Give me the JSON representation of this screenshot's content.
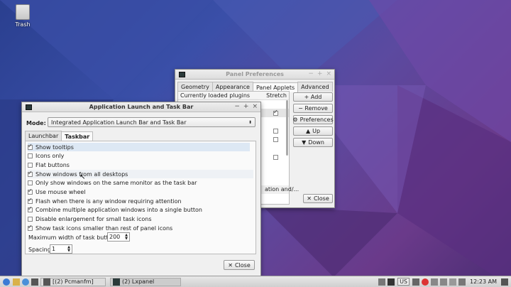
{
  "desktop": {
    "trash_label": "Trash"
  },
  "panel_prefs": {
    "title": "Panel Preferences",
    "tabs": [
      "Geometry",
      "Appearance",
      "Panel Applets",
      "Advanced"
    ],
    "list_header": "Currently loaded plugins",
    "stretch_header": "Stretch",
    "partial_row_text": "ation and/...",
    "buttons": {
      "add": "+ Add",
      "remove": "− Remove",
      "preferences": "Preferences",
      "up": "Up",
      "down": "Down",
      "close": "Close"
    }
  },
  "app_launch": {
    "title": "Application Launch and Task Bar",
    "mode_label": "Mode:",
    "mode_value": "Integrated Application Launch Bar and Task Bar",
    "tabs": [
      "Launchbar",
      "Taskbar"
    ],
    "options": [
      {
        "label": "Show tooltips",
        "checked": true
      },
      {
        "label": "Icons only",
        "checked": false
      },
      {
        "label": "Flat buttons",
        "checked": false
      },
      {
        "label": "Show windows from all desktops",
        "checked": true
      },
      {
        "label": "Only show windows on the same monitor as the task bar",
        "checked": false
      },
      {
        "label": "Use mouse wheel",
        "checked": true
      },
      {
        "label": "Flash when there is any window requiring attention",
        "checked": true
      },
      {
        "label": "Combine multiple application windows into a single button",
        "checked": true
      },
      {
        "label": "Disable enlargement for small task icons",
        "checked": false
      },
      {
        "label": "Show task icons smaller than rest of panel icons",
        "checked": true
      }
    ],
    "max_width_label": "Maximum width of task button",
    "max_width_value": "200",
    "spacing_label": "Spacing",
    "spacing_value": "1",
    "close_label": "Close"
  },
  "taskbar": {
    "tasks": [
      "[(2) Pcmanfm]",
      "(2) Lxpanel"
    ],
    "keyboard_layout": "US",
    "clock": "12:23 AM"
  }
}
